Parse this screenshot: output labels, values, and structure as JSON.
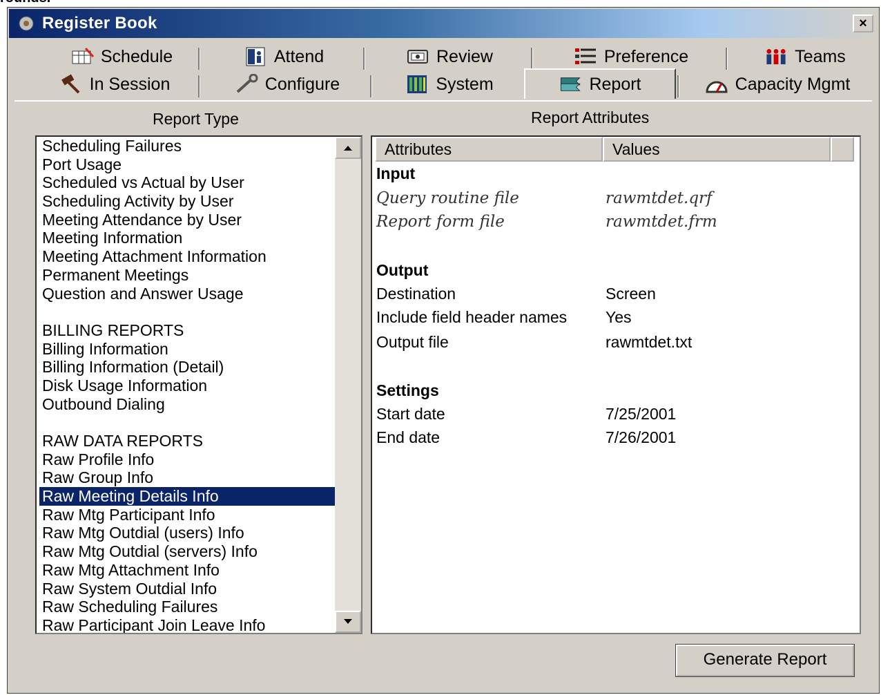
{
  "clipped_top_text": "rounds.",
  "window": {
    "title": "Register Book",
    "close_label": "×"
  },
  "tabs_row1": [
    {
      "label": "Schedule",
      "icon": "schedule-icon"
    },
    {
      "label": "Attend",
      "icon": "attend-icon"
    },
    {
      "label": "Review",
      "icon": "review-icon"
    },
    {
      "label": "Preference",
      "icon": "preference-icon"
    },
    {
      "label": "Teams",
      "icon": "teams-icon"
    }
  ],
  "tabs_row2": [
    {
      "label": "In Session",
      "icon": "gavel-icon"
    },
    {
      "label": "Configure",
      "icon": "wrench-icon"
    },
    {
      "label": "System",
      "icon": "system-icon"
    },
    {
      "label": "Report",
      "icon": "report-icon",
      "active": true
    },
    {
      "label": "Capacity Mgmt",
      "icon": "gauge-icon"
    }
  ],
  "report_type": {
    "heading": "Report Type",
    "items": [
      "Scheduling Failures",
      "Port Usage",
      "Scheduled vs Actual by User",
      "Scheduling Activity by User",
      "Meeting Attendance by User",
      "Meeting Information",
      "Meeting Attachment Information",
      "Permanent Meetings",
      "Question and Answer Usage",
      "",
      "BILLING REPORTS",
      "Billing Information",
      "Billing Information (Detail)",
      "Disk Usage Information",
      "Outbound Dialing",
      "",
      "RAW DATA REPORTS",
      "Raw Profile Info",
      "Raw Group Info",
      "Raw Meeting Details Info",
      "Raw Mtg Participant Info",
      "Raw Mtg Outdial (users) Info",
      "Raw Mtg Outdial (servers) Info",
      "Raw Mtg Attachment Info",
      "Raw System Outdial Info",
      "Raw Scheduling Failures",
      "Raw Participant Join Leave Info"
    ],
    "selected": "Raw Meeting Details Info"
  },
  "report_attributes": {
    "heading": "Report Attributes",
    "col_attributes": "Attributes",
    "col_values": "Values",
    "input_heading": "Input",
    "query_label": "Query routine file",
    "query_value": "rawmtdet.qrf",
    "form_label": "Report form file",
    "form_value": "rawmtdet.frm",
    "output_heading": "Output",
    "destination_label": "Destination",
    "destination_value": "Screen",
    "header_names_label": "Include field header names",
    "header_names_value": "Yes",
    "output_file_label": "Output file",
    "output_file_value": "rawmtdet.txt",
    "settings_heading": "Settings",
    "start_label": "Start date",
    "start_value": "7/25/2001",
    "end_label": "End date",
    "end_value": "7/26/2001"
  },
  "generate_button": "Generate Report"
}
